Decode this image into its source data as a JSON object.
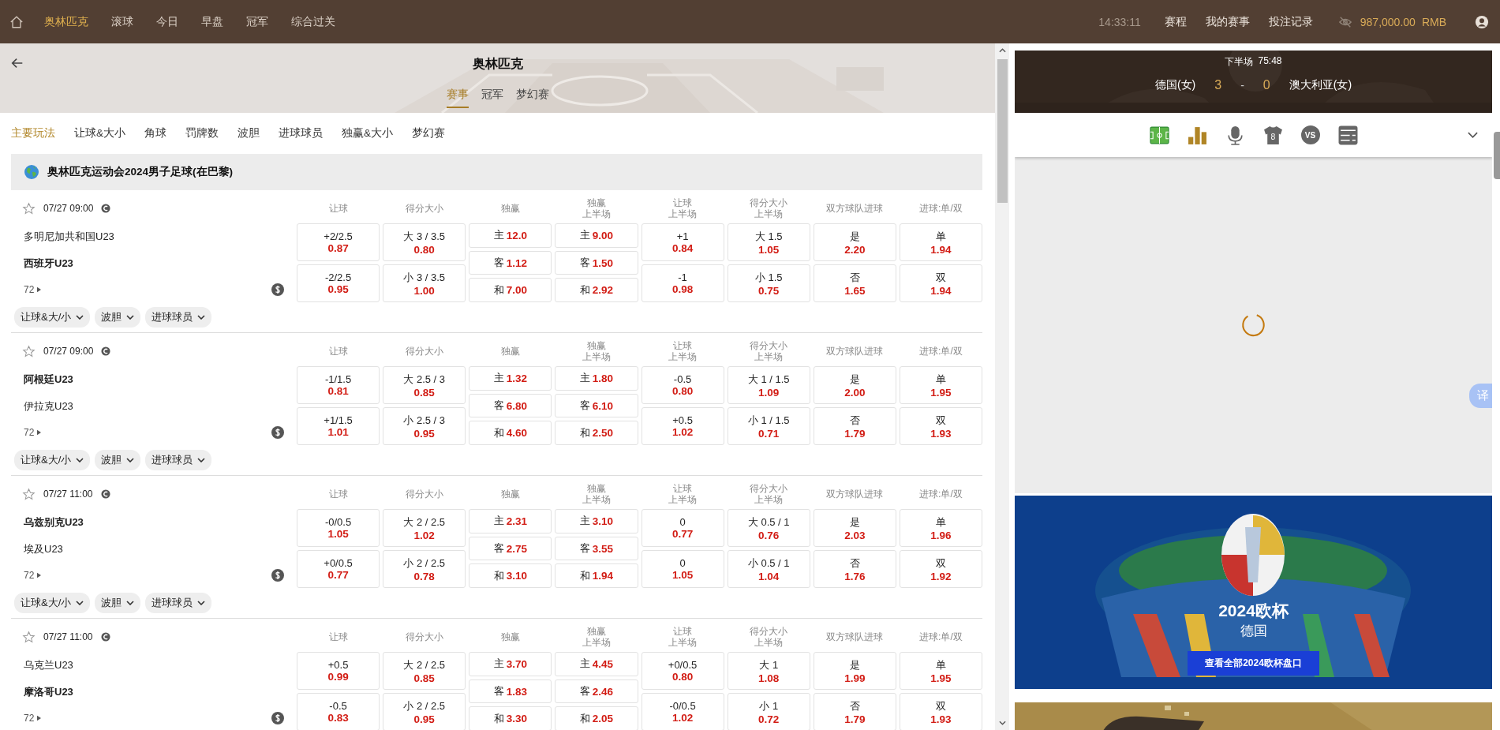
{
  "topbar": {
    "nav": [
      {
        "label": "奥林匹克",
        "selected": true
      },
      {
        "label": "滚球",
        "selected": false
      },
      {
        "label": "今日",
        "selected": false
      },
      {
        "label": "早盘",
        "selected": false
      },
      {
        "label": "冠军",
        "selected": false
      },
      {
        "label": "综合过关",
        "selected": false
      }
    ],
    "clock": "14:33:11",
    "links": [
      "赛程",
      "我的赛事",
      "投注记录"
    ],
    "balance": "987,000.00",
    "currency": "RMB"
  },
  "header": {
    "title": "奥林匹克",
    "tabs": [
      {
        "label": "赛事",
        "selected": true
      },
      {
        "label": "冠军",
        "selected": false
      },
      {
        "label": "梦幻赛",
        "selected": false
      }
    ]
  },
  "bet_types": [
    {
      "label": "主要玩法",
      "selected": true
    },
    {
      "label": "让球&大小",
      "selected": false
    },
    {
      "label": "角球",
      "selected": false
    },
    {
      "label": "罚牌数",
      "selected": false
    },
    {
      "label": "波胆",
      "selected": false
    },
    {
      "label": "进球球员",
      "selected": false
    },
    {
      "label": "独赢&大小",
      "selected": false
    },
    {
      "label": "梦幻赛",
      "selected": false
    }
  ],
  "league": {
    "title": "奥林匹克运动会2024男子足球(在巴黎)"
  },
  "matches": [
    {
      "time": "07/27 09:00",
      "teams": [
        {
          "name": "多明尼加共和国U23",
          "bold": false
        },
        {
          "name": "西班牙U23",
          "bold": true
        }
      ],
      "more": "72",
      "markets": [
        {
          "title": "让球",
          "kind": "pair",
          "cells": [
            {
              "line": "+2/2.5",
              "odds": "0.87"
            },
            {
              "line": "-2/2.5",
              "odds": "0.95"
            }
          ]
        },
        {
          "title": "得分大小",
          "kind": "pair",
          "cells": [
            {
              "line": "大 3 / 3.5",
              "odds": "0.80"
            },
            {
              "line": "小 3 / 3.5",
              "odds": "1.00"
            }
          ]
        },
        {
          "title": "独赢",
          "kind": "triple",
          "cells": [
            {
              "line": "主",
              "odds": "12.0"
            },
            {
              "line": "客",
              "odds": "1.12"
            },
            {
              "line": "和",
              "odds": "7.00"
            }
          ]
        },
        {
          "title": "独赢",
          "subtitle": "上半场",
          "kind": "triple",
          "cells": [
            {
              "line": "主",
              "odds": "9.00"
            },
            {
              "line": "客",
              "odds": "1.50"
            },
            {
              "line": "和",
              "odds": "2.92"
            }
          ]
        },
        {
          "title": "让球",
          "subtitle": "上半场",
          "kind": "pair",
          "cells": [
            {
              "line": "+1",
              "odds": "0.84"
            },
            {
              "line": "-1",
              "odds": "0.98"
            }
          ]
        },
        {
          "title": "得分大小",
          "subtitle": "上半场",
          "kind": "pair",
          "cells": [
            {
              "line": "大 1.5",
              "odds": "1.05"
            },
            {
              "line": "小 1.5",
              "odds": "0.75"
            }
          ]
        },
        {
          "title": "双方球队进球",
          "kind": "pair",
          "cells": [
            {
              "line": "是",
              "odds": "2.20"
            },
            {
              "line": "否",
              "odds": "1.65"
            }
          ]
        },
        {
          "title": "进球:单/双",
          "kind": "pair",
          "cells": [
            {
              "line": "单",
              "odds": "1.94"
            },
            {
              "line": "双",
              "odds": "1.94"
            }
          ]
        }
      ],
      "filters": [
        "让球&大/小",
        "波胆",
        "进球球员"
      ]
    },
    {
      "time": "07/27 09:00",
      "teams": [
        {
          "name": "阿根廷U23",
          "bold": true
        },
        {
          "name": "伊拉克U23",
          "bold": false
        }
      ],
      "more": "72",
      "markets": [
        {
          "title": "让球",
          "kind": "pair",
          "cells": [
            {
              "line": "-1/1.5",
              "odds": "0.81"
            },
            {
              "line": "+1/1.5",
              "odds": "1.01"
            }
          ]
        },
        {
          "title": "得分大小",
          "kind": "pair",
          "cells": [
            {
              "line": "大 2.5 / 3",
              "odds": "0.85"
            },
            {
              "line": "小 2.5 / 3",
              "odds": "0.95"
            }
          ]
        },
        {
          "title": "独赢",
          "kind": "triple",
          "cells": [
            {
              "line": "主",
              "odds": "1.32"
            },
            {
              "line": "客",
              "odds": "6.80"
            },
            {
              "line": "和",
              "odds": "4.60"
            }
          ]
        },
        {
          "title": "独赢",
          "subtitle": "上半场",
          "kind": "triple",
          "cells": [
            {
              "line": "主",
              "odds": "1.80"
            },
            {
              "line": "客",
              "odds": "6.10"
            },
            {
              "line": "和",
              "odds": "2.50"
            }
          ]
        },
        {
          "title": "让球",
          "subtitle": "上半场",
          "kind": "pair",
          "cells": [
            {
              "line": "-0.5",
              "odds": "0.80"
            },
            {
              "line": "+0.5",
              "odds": "1.02"
            }
          ]
        },
        {
          "title": "得分大小",
          "subtitle": "上半场",
          "kind": "pair",
          "cells": [
            {
              "line": "大 1 / 1.5",
              "odds": "1.09"
            },
            {
              "line": "小 1 / 1.5",
              "odds": "0.71"
            }
          ]
        },
        {
          "title": "双方球队进球",
          "kind": "pair",
          "cells": [
            {
              "line": "是",
              "odds": "2.00"
            },
            {
              "line": "否",
              "odds": "1.79"
            }
          ]
        },
        {
          "title": "进球:单/双",
          "kind": "pair",
          "cells": [
            {
              "line": "单",
              "odds": "1.95"
            },
            {
              "line": "双",
              "odds": "1.93"
            }
          ]
        }
      ],
      "filters": [
        "让球&大/小",
        "波胆",
        "进球球员"
      ]
    },
    {
      "time": "07/27 11:00",
      "teams": [
        {
          "name": "乌兹别克U23",
          "bold": true
        },
        {
          "name": "埃及U23",
          "bold": false
        }
      ],
      "more": "72",
      "markets": [
        {
          "title": "让球",
          "kind": "pair",
          "cells": [
            {
              "line": "-0/0.5",
              "odds": "1.05"
            },
            {
              "line": "+0/0.5",
              "odds": "0.77"
            }
          ]
        },
        {
          "title": "得分大小",
          "kind": "pair",
          "cells": [
            {
              "line": "大 2 / 2.5",
              "odds": "1.02"
            },
            {
              "line": "小 2 / 2.5",
              "odds": "0.78"
            }
          ]
        },
        {
          "title": "独赢",
          "kind": "triple",
          "cells": [
            {
              "line": "主",
              "odds": "2.31"
            },
            {
              "line": "客",
              "odds": "2.75"
            },
            {
              "line": "和",
              "odds": "3.10"
            }
          ]
        },
        {
          "title": "独赢",
          "subtitle": "上半场",
          "kind": "triple",
          "cells": [
            {
              "line": "主",
              "odds": "3.10"
            },
            {
              "line": "客",
              "odds": "3.55"
            },
            {
              "line": "和",
              "odds": "1.94"
            }
          ]
        },
        {
          "title": "让球",
          "subtitle": "上半场",
          "kind": "pair",
          "cells": [
            {
              "line": "0",
              "odds": "0.77"
            },
            {
              "line": "0",
              "odds": "1.05"
            }
          ]
        },
        {
          "title": "得分大小",
          "subtitle": "上半场",
          "kind": "pair",
          "cells": [
            {
              "line": "大 0.5 / 1",
              "odds": "0.76"
            },
            {
              "line": "小 0.5 / 1",
              "odds": "1.04"
            }
          ]
        },
        {
          "title": "双方球队进球",
          "kind": "pair",
          "cells": [
            {
              "line": "是",
              "odds": "2.03"
            },
            {
              "line": "否",
              "odds": "1.76"
            }
          ]
        },
        {
          "title": "进球:单/双",
          "kind": "pair",
          "cells": [
            {
              "line": "单",
              "odds": "1.96"
            },
            {
              "line": "双",
              "odds": "1.92"
            }
          ]
        }
      ],
      "filters": [
        "让球&大/小",
        "波胆",
        "进球球员"
      ]
    },
    {
      "time": "07/27 11:00",
      "teams": [
        {
          "name": "乌克兰U23",
          "bold": false
        },
        {
          "name": "摩洛哥U23",
          "bold": true
        }
      ],
      "more": "72",
      "markets": [
        {
          "title": "让球",
          "kind": "pair",
          "cells": [
            {
              "line": "+0.5",
              "odds": "0.99"
            },
            {
              "line": "-0.5",
              "odds": "0.83"
            }
          ]
        },
        {
          "title": "得分大小",
          "kind": "pair",
          "cells": [
            {
              "line": "大 2 / 2.5",
              "odds": "0.85"
            },
            {
              "line": "小 2 / 2.5",
              "odds": "0.95"
            }
          ]
        },
        {
          "title": "独赢",
          "kind": "triple",
          "cells": [
            {
              "line": "主",
              "odds": "3.70"
            },
            {
              "line": "客",
              "odds": "1.83"
            },
            {
              "line": "和",
              "odds": "3.30"
            }
          ]
        },
        {
          "title": "独赢",
          "subtitle": "上半场",
          "kind": "triple",
          "cells": [
            {
              "line": "主",
              "odds": "4.45"
            },
            {
              "line": "客",
              "odds": "2.46"
            },
            {
              "line": "和",
              "odds": "2.05"
            }
          ]
        },
        {
          "title": "让球",
          "subtitle": "上半场",
          "kind": "pair",
          "cells": [
            {
              "line": "+0/0.5",
              "odds": "0.80"
            },
            {
              "line": "-0/0.5",
              "odds": "1.02"
            }
          ]
        },
        {
          "title": "得分大小",
          "subtitle": "上半场",
          "kind": "pair",
          "cells": [
            {
              "line": "大 1",
              "odds": "1.08"
            },
            {
              "line": "小 1",
              "odds": "0.72"
            }
          ]
        },
        {
          "title": "双方球队进球",
          "kind": "pair",
          "cells": [
            {
              "line": "是",
              "odds": "1.99"
            },
            {
              "line": "否",
              "odds": "1.79"
            }
          ]
        },
        {
          "title": "进球:单/双",
          "kind": "pair",
          "cells": [
            {
              "line": "单",
              "odds": "1.95"
            },
            {
              "line": "双",
              "odds": "1.93"
            }
          ]
        }
      ]
    }
  ],
  "live": {
    "period": "下半场",
    "clock": "75:48",
    "home": "德国(女)",
    "home_score": "3",
    "separator": "-",
    "away_score": "0",
    "away": "澳大利亚(女)"
  },
  "tools": {
    "jersey_number": "8",
    "versus": "VS"
  },
  "promo": {
    "title": "2024欧杯",
    "subtitle": "德国",
    "button": "查看全部2024欧杯盘口"
  },
  "translate_badge": "译"
}
